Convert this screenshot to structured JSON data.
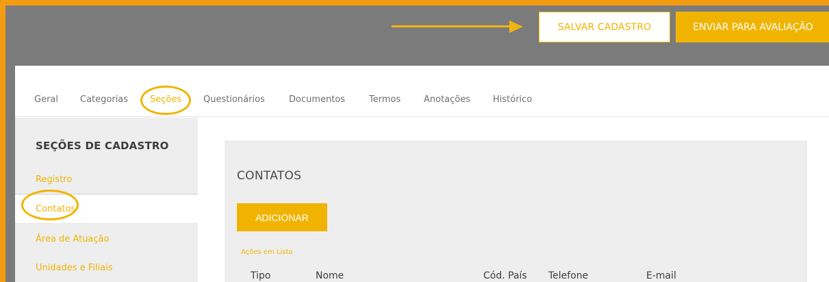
{
  "toolbar": {
    "save_label": "SALVAR CADASTRO",
    "send_label": "ENVIAR PARA AVALIAÇÃO"
  },
  "tabs": [
    {
      "label": "Geral",
      "active": false
    },
    {
      "label": "Categorias",
      "active": false
    },
    {
      "label": "Seções",
      "active": true
    },
    {
      "label": "Questionários",
      "active": false
    },
    {
      "label": "Documentos",
      "active": false
    },
    {
      "label": "Termos",
      "active": false
    },
    {
      "label": "Anotações",
      "active": false
    },
    {
      "label": "Histórico",
      "active": false
    }
  ],
  "sidebar": {
    "title": "SEÇÕES DE CADASTRO",
    "items": [
      {
        "label": "Registro",
        "active": false
      },
      {
        "label": "Contatos",
        "active": true
      },
      {
        "label": "Área de Atuação",
        "active": false
      },
      {
        "label": "Unidades e Filiais",
        "active": false
      }
    ]
  },
  "main": {
    "title": "CONTATOS",
    "add_label": "ADICIONAR",
    "list_actions_label": "Ações em Lista",
    "columns": [
      "Tipo",
      "Nome",
      "Cód. País",
      "Telefone",
      "E-mail"
    ]
  },
  "colors": {
    "accent": "#f0b400",
    "frame": "#f39c12",
    "header_bg": "#7b7b7b"
  }
}
